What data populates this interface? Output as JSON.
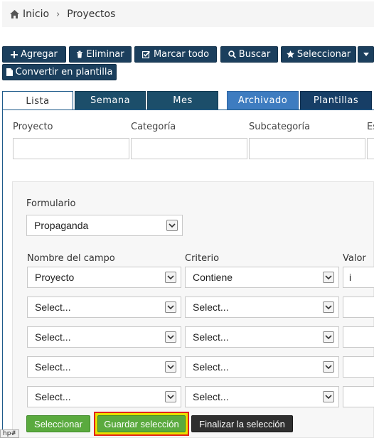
{
  "breadcrumb": {
    "home_label": "Inicio",
    "current_label": "Proyectos"
  },
  "toolbar": {
    "add_label": "Agregar",
    "delete_label": "Eliminar",
    "mark_all_label": "Marcar todo",
    "search_label": "Buscar",
    "select_label": "Seleccionar",
    "template_label": "Convertir en plantilla"
  },
  "tabs": [
    {
      "label": "Lista"
    },
    {
      "label": "Semana"
    },
    {
      "label": "Mes"
    },
    {
      "label": "Archivado"
    },
    {
      "label": "Plantillas"
    }
  ],
  "columns": [
    {
      "label": "Proyecto"
    },
    {
      "label": "Categoría"
    },
    {
      "label": "Subcategoría"
    },
    {
      "label": "Es"
    }
  ],
  "filter": {
    "form_label": "Formulario",
    "form_value": "Propaganda",
    "field_header": "Nombre del campo",
    "criteria_header": "Criterio",
    "value_header": "Valor",
    "rows": [
      {
        "field": "Proyecto",
        "criteria": "Contiene",
        "value": "i"
      },
      {
        "field": "Select...",
        "criteria": "Select...",
        "value": ""
      },
      {
        "field": "Select...",
        "criteria": "Select...",
        "value": ""
      },
      {
        "field": "Select...",
        "criteria": "Select...",
        "value": ""
      },
      {
        "field": "Select...",
        "criteria": "Select...",
        "value": ""
      }
    ]
  },
  "actions": {
    "select_label": "Seleccionar",
    "save_label": "Guardar selección",
    "finish_label": "Finalizar la selección"
  },
  "status_bar": {
    "text": "hp#"
  }
}
